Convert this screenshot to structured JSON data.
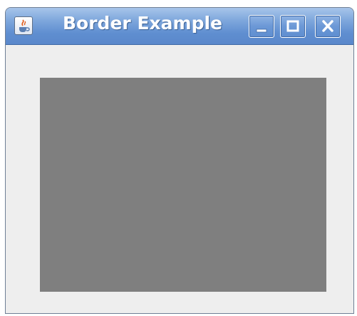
{
  "window": {
    "title": "Border Example",
    "icon": "java-coffee-cup-icon",
    "controls": [
      "minimize-icon",
      "maximize-icon",
      "close-icon"
    ]
  },
  "colors": {
    "titlebar": "#5f8ed0",
    "content_background": "#eeeeee",
    "panel": "#7f7f7f"
  }
}
